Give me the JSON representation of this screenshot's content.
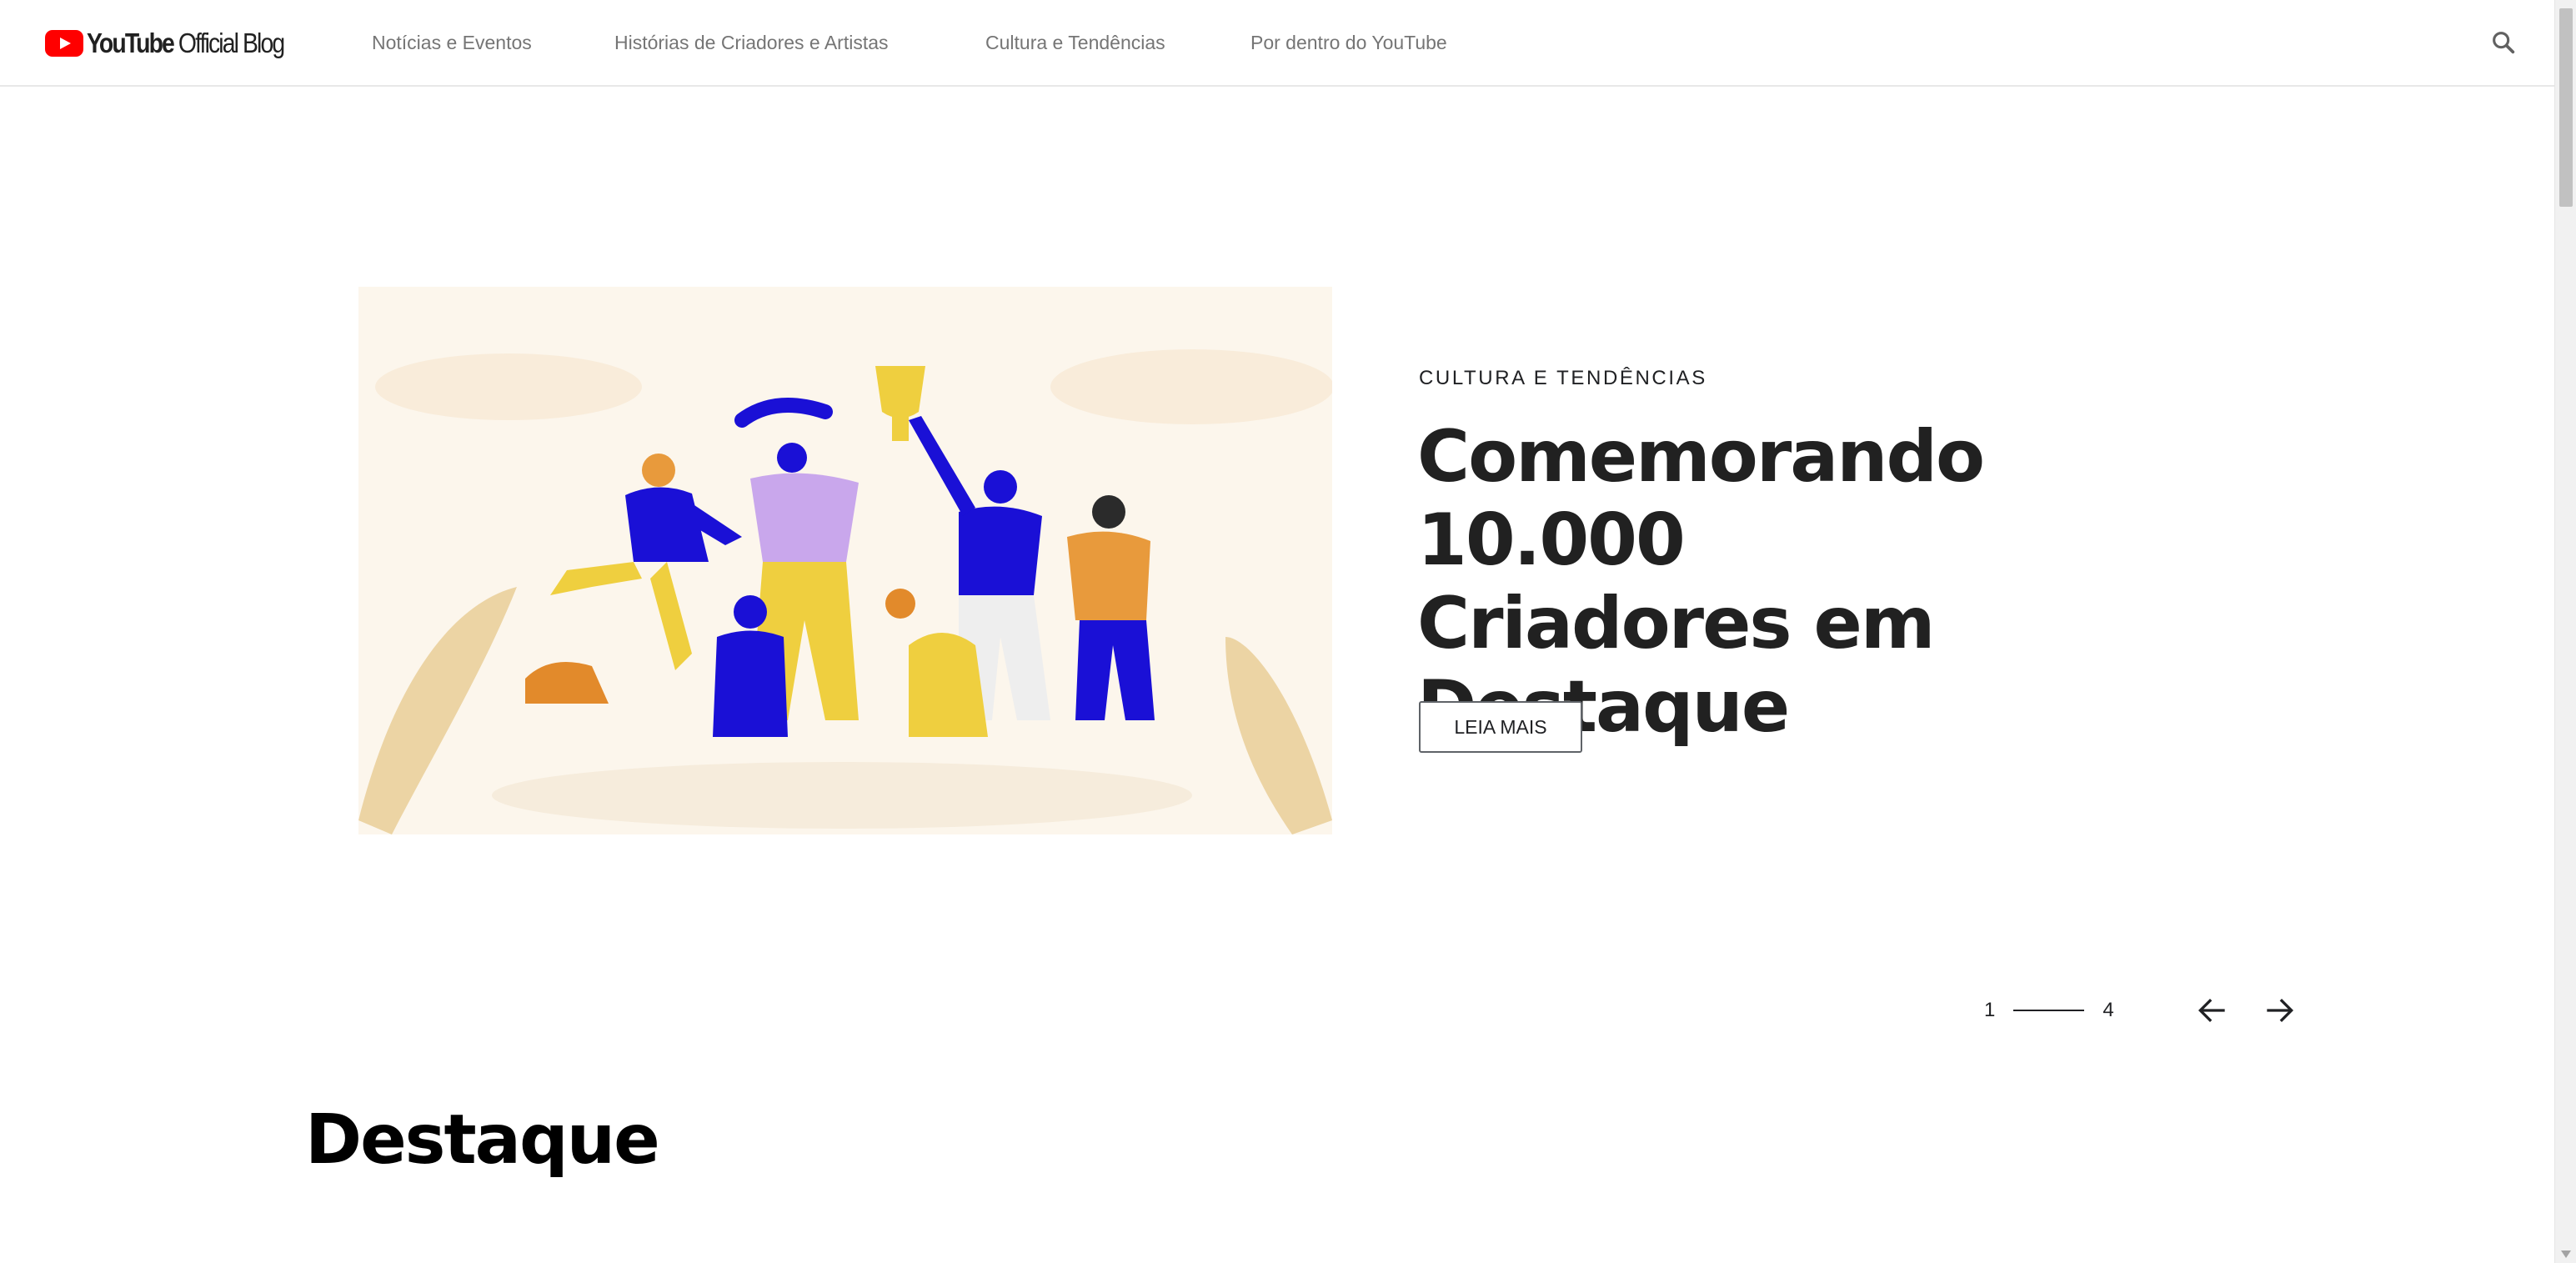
{
  "header": {
    "logo": {
      "brand": "YouTube",
      "suffix": "Official Blog"
    },
    "nav": [
      {
        "label": "Notícias e Eventos"
      },
      {
        "label": "Histórias de Criadores e Artistas"
      },
      {
        "label": "Cultura e Tendências"
      },
      {
        "label": "Por dentro do YouTube"
      }
    ],
    "search_icon": "search-icon"
  },
  "hero": {
    "category": "CULTURA E TENDÊNCIAS",
    "title": "Comemorando 10.000 Criadores em Destaque",
    "button_label": "LEIA MAIS",
    "image": "illustration-people-celebrating-trophy"
  },
  "carousel": {
    "current": "1",
    "total": "4",
    "prev_icon": "arrow-left-icon",
    "next_icon": "arrow-right-icon"
  },
  "section": {
    "title": "Destaque"
  },
  "colors": {
    "brand_red": "#ff0000",
    "nav_text": "#757575",
    "title_text": "#212121",
    "accent_blue": "#1a10d6",
    "accent_yellow": "#efcf3f",
    "accent_orange": "#e28a2b",
    "accent_lavender": "#c9a7ec"
  }
}
